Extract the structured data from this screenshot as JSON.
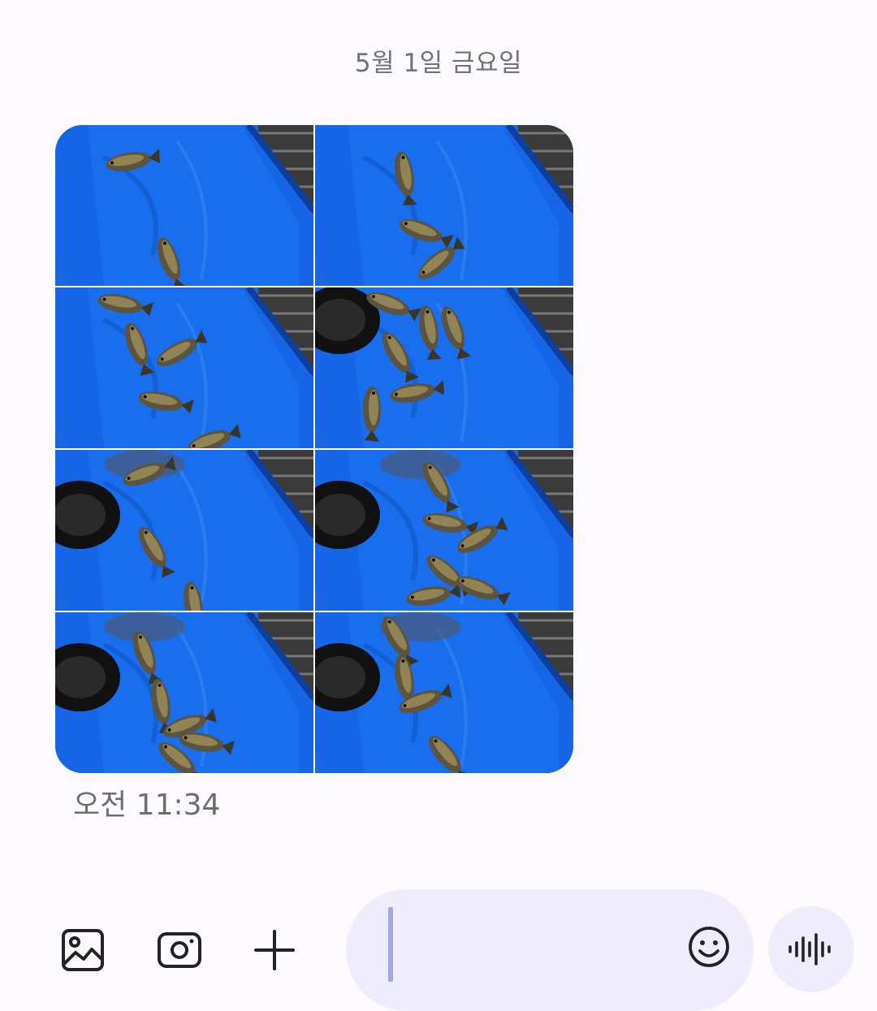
{
  "conversation": {
    "date_header": "5월 1일 금요일"
  },
  "message": {
    "photo_count": 8,
    "photos": [
      {
        "icon": "fish-photo-thumbnail"
      },
      {
        "icon": "fish-photo-thumbnail"
      },
      {
        "icon": "fish-photo-thumbnail"
      },
      {
        "icon": "fish-photo-thumbnail"
      },
      {
        "icon": "fish-photo-thumbnail"
      },
      {
        "icon": "fish-photo-thumbnail"
      },
      {
        "icon": "fish-photo-thumbnail"
      },
      {
        "icon": "fish-photo-thumbnail"
      }
    ],
    "timestamp": "오전 11:34"
  },
  "composer": {
    "input_value": "",
    "icons": {
      "gallery": "gallery-icon",
      "camera": "camera-icon",
      "add": "plus-icon",
      "emoji": "emoji-icon",
      "voice": "voice-waveform-icon"
    }
  },
  "colors": {
    "background": "#fcfaff",
    "composer_fill": "#efedfc",
    "cursor": "#a3a7e8",
    "tarp_blue": "#1560d8",
    "text_gray": "#717171"
  }
}
